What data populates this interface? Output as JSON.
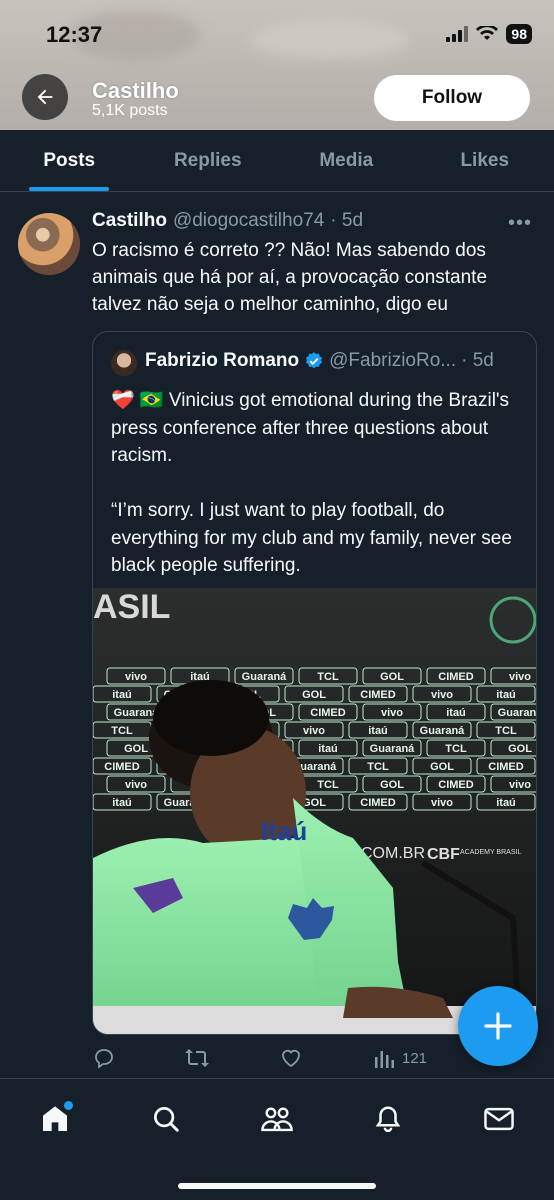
{
  "status": {
    "time": "12:37",
    "battery": "98"
  },
  "header": {
    "name": "Castilho",
    "posts": "5,1K posts",
    "follow_label": "Follow"
  },
  "tabs": [
    {
      "label": "Posts"
    },
    {
      "label": "Replies"
    },
    {
      "label": "Media"
    },
    {
      "label": "Likes"
    }
  ],
  "tweet": {
    "name": "Castilho",
    "handle": "@diogocastilho74",
    "time": "· 5d",
    "text": "O racismo é correto ?? Não! Mas sabendo dos animais que há por aí, a provocação constante talvez não seja o melhor caminho, digo eu",
    "quote": {
      "name": "Fabrizio Romano",
      "handle": "@FabrizioRo...",
      "time": "· 5d",
      "text": "❤️‍🩹 🇧🇷 Vinicius got emotional during the Brazil's press conference after three questions about racism.\n\n“I’m sorry. I just want to play football, do everything for my club and my family, never see black people suffering.",
      "media_sponsor_words": [
        "vivo",
        "itaú",
        "Guaraná",
        "TCL",
        "GOL",
        "CIMED"
      ],
      "media_banner_text": "ASIL",
      "media_bottom_text": "COM.BR",
      "media_cbf_text": "CBF",
      "media_academy_text": "ACADEMY BRASIL",
      "media_shirt_text": "Itaú"
    },
    "views": "121"
  },
  "colors": {
    "accent": "#1d9bf0",
    "background": "#15202b",
    "muted": "#8b98a5",
    "jersey": "#8fe5a4"
  },
  "icons": [
    "back-arrow-icon",
    "verified-badge-icon",
    "reply-icon",
    "retweet-icon",
    "like-icon",
    "views-icon",
    "compose-icon",
    "home-icon",
    "search-icon",
    "communities-icon",
    "notifications-icon",
    "messages-icon"
  ]
}
